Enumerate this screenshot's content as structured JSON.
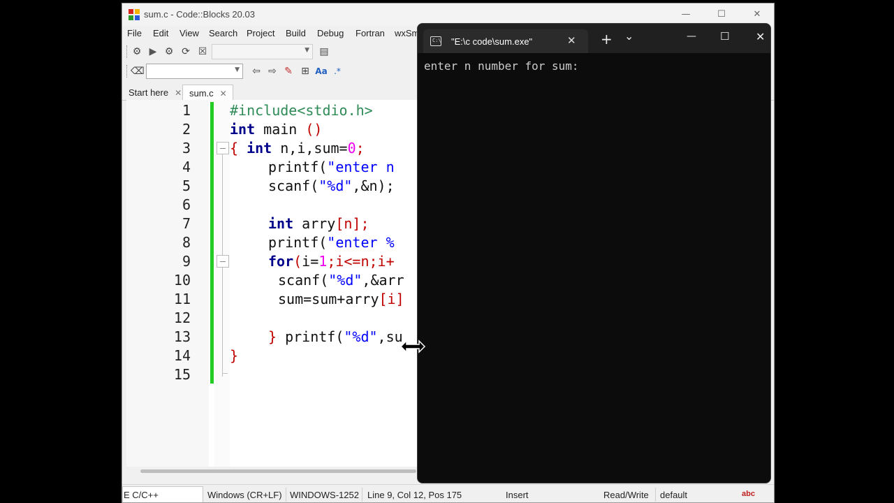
{
  "codeblocks": {
    "title": "sum.c - Code::Blocks 20.03",
    "window_controls": {
      "minimize": "—",
      "maximize": "☐",
      "close": "✕"
    },
    "menu": [
      "File",
      "Edit",
      "View",
      "Search",
      "Project",
      "Build",
      "Debug",
      "Fortran",
      "wxSm"
    ],
    "tabs": [
      {
        "label": "Start here",
        "close": "✕"
      },
      {
        "label": "sum.c",
        "close": "✕"
      }
    ],
    "line_numbers": [
      "1",
      "2",
      "3",
      "4",
      "5",
      "6",
      "7",
      "8",
      "9",
      "10",
      "11",
      "12",
      "13",
      "14",
      "15"
    ],
    "code": {
      "l1_pre": "#include<stdio.h>",
      "l2_kw": "int",
      "l2_txt": " main ",
      "l2_op": "()",
      "l3_brace": "{",
      "l3_kw": "int",
      "l3_txt": " n,i,sum=",
      "l3_num": "0",
      "l3_end": ";",
      "l4_fn": "printf(",
      "l4_str": "\"enter n",
      "l5_fn": "scanf(",
      "l5_str": "\"%d\"",
      "l5_rest": ",&n);",
      "l7_kw": "int",
      "l7_txt": " arry",
      "l7_rest": "[n];",
      "l8_fn": "printf(",
      "l8_str": "\"enter %",
      "l9_kw": "for",
      "l9_op1": "(",
      "l9_txt": "i=",
      "l9_num": "1",
      "l9_rest": ";i<=n;i+",
      "l10_fn": "scanf(",
      "l10_str": "\"%d\"",
      "l10_rest": ",&arr",
      "l11_txt": "sum=sum+arry",
      "l11_rest": "[i]",
      "l13_brace": "}",
      "l13_fn": " printf(",
      "l13_str": "\"%d\"",
      "l13_rest": ",su",
      "l14_brace": "}"
    },
    "status": {
      "language": "E C/C++",
      "line_endings": "Windows (CR+LF)",
      "encoding": "WINDOWS-1252",
      "position": "Line 9, Col 12, Pos 175",
      "mode": "Insert",
      "access": "Read/Write",
      "profile": "default"
    }
  },
  "terminal": {
    "tab_title": "\"E:\\c code\\sum.exe\"",
    "icon_text": "C:\\",
    "tab_close": "✕",
    "new_tab": "+",
    "dropdown": "⌄",
    "minimize": "—",
    "maximize": "☐",
    "close": "✕",
    "output": "enter n number for sum:"
  },
  "colors": {
    "keyword": "#00008b",
    "preprocessor": "#2e8b57",
    "string": "#0000ff",
    "number": "#ee00ee",
    "operator": "#c00000",
    "change_bar": "#22cc22",
    "terminal_bg": "#0c0c0c"
  }
}
